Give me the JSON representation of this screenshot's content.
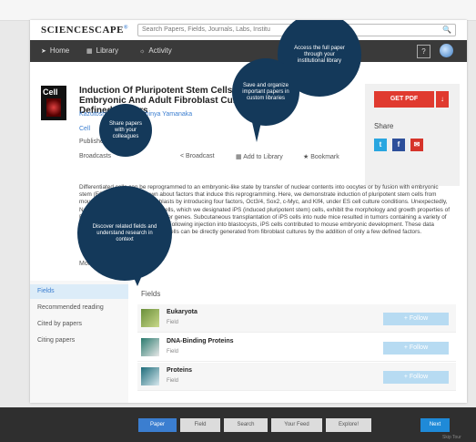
{
  "brand": {
    "name": "SCIENCESCAPE",
    "mark": "®"
  },
  "search": {
    "placeholder": "Search Papers, Fields, Journals, Labs, Institu",
    "icon": "search-icon"
  },
  "nav": {
    "items": [
      {
        "label": "Home",
        "icon": "arrow-icon"
      },
      {
        "label": "Library",
        "icon": "library-icon"
      },
      {
        "label": "Activity",
        "icon": "activity-icon"
      }
    ],
    "help": "?"
  },
  "paper": {
    "journal_cover": "Cell",
    "title": "Induction Of Pluripotent Stem Cells From Mouse Embryonic And Adult Fibroblast Cultures By Defined Factors",
    "authors": "Kazutoshi Takahashi, Shinya Yamanaka",
    "journal": "Cell",
    "published": "Published",
    "broadcasts_label": "Broadcasts",
    "actions": {
      "broadcast": "Broadcast",
      "add_to_library": "Add to Library",
      "bookmark": "Bookmark"
    },
    "abstract": "Differentiated cells can be reprogrammed to an embryonic-like state by transfer of nuclear contents into oocytes or by fusion with embryonic stem (ES) cells. Little is known about factors that induce this reprogramming. Here, we demonstrate induction of pluripotent stem cells from mouse embryonic or adult fibroblasts by introducing four factors, Oct3/4, Sox2, c-Myc, and Klf4, under ES cell culture conditions. Unexpectedly, Nanog was dispensable. These cells, which we designated iPS (induced pluripotent stem) cells, exhibit the morphology and growth properties of ES cells and express ES cell marker genes. Subcutaneous transplantation of iPS cells into nude mice resulted in tumors containing a variety of tissues from all three germ layers. Following injection into blastocysts, iPS cells contributed to mouse embryonic development. These data demonstrate that pluripotent stem cells can be directly generated from fibroblast cultures by the addition of only a few defined factors.",
    "more": "More"
  },
  "sidebox": {
    "get_pdf": "GET PDF",
    "arrow": "↓",
    "share": "Share",
    "twitter": "t",
    "facebook": "f",
    "email": "✉"
  },
  "sidebar": {
    "items": [
      {
        "label": "Fields"
      },
      {
        "label": "Recommended reading"
      },
      {
        "label": "Cited by papers"
      },
      {
        "label": "Citing papers"
      }
    ]
  },
  "fields": {
    "heading": "Fields",
    "rows": [
      {
        "name": "Eukaryota",
        "sub": "Field",
        "button": "+ Follow"
      },
      {
        "name": "DNA-Binding Proteins",
        "sub": "Field",
        "button": "+ Follow"
      },
      {
        "name": "Proteins",
        "sub": "Field",
        "button": "+ Follow"
      }
    ]
  },
  "bubbles": {
    "pdf": "Access the full paper through your institutional library",
    "library": "Save and organize important papers in custom libraries",
    "share": "Share papers with your colleagues",
    "fields": "Discover related fields and understand research in context"
  },
  "footer": {
    "steps": [
      "Paper",
      "Field",
      "Search",
      "Your Feed",
      "Explore!"
    ],
    "next": "Next",
    "skip": "Skip Tour"
  },
  "colors": {
    "accent": "#3b7ed0",
    "pdf": "#e03a2f",
    "bubble": "#14395a",
    "follow": "#b7dbf2"
  }
}
